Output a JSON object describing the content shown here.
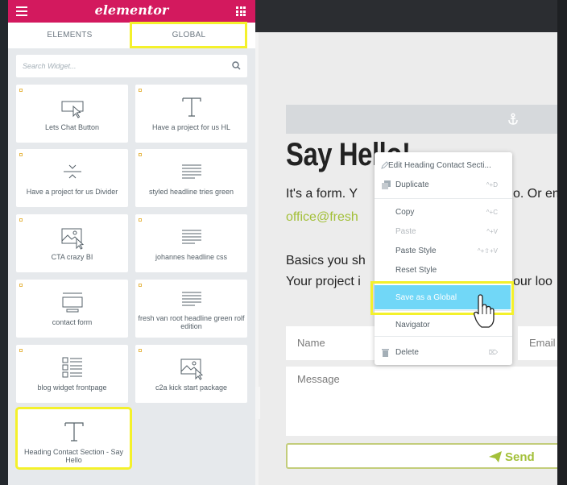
{
  "panel": {
    "logo": "elementor",
    "tabs": {
      "elements": "ELEMENTS",
      "global": "GLOBAL"
    },
    "search": {
      "placeholder": "Search Widget..."
    },
    "widgets": [
      {
        "label": "Lets Chat Button",
        "icon": "button-icon"
      },
      {
        "label": "Have a project for us HL",
        "icon": "heading-icon"
      },
      {
        "label": "Have a project for us Divider",
        "icon": "divider-icon"
      },
      {
        "label": "styled headline tries green",
        "icon": "text-editor-icon"
      },
      {
        "label": "CTA crazy BI",
        "icon": "image-icon"
      },
      {
        "label": "johannes headline css",
        "icon": "text-editor-icon"
      },
      {
        "label": "contact form",
        "icon": "form-icon"
      },
      {
        "label": "fresh van root headline green rolf edition",
        "icon": "text-editor-icon"
      },
      {
        "label": "blog widget frontpage",
        "icon": "posts-icon"
      },
      {
        "label": "c2a kick start package",
        "icon": "image-icon"
      },
      {
        "label": "Heading Contact Section - Say Hello",
        "icon": "heading-icon"
      }
    ]
  },
  "canvas": {
    "heading": "Say Hello!",
    "line1": "It's a form. Y",
    "line1_tail": "o. Or em",
    "email": "office@fresh",
    "line2": "Basics you sh",
    "line3": "Your project i",
    "line3_tail": "our loo",
    "name_placeholder": "Name",
    "email_placeholder": "Email",
    "message_placeholder": "Message",
    "send": "Send"
  },
  "context_menu": {
    "items": [
      {
        "label": "Edit Heading Contact Secti...",
        "shortcut": ""
      },
      {
        "label": "Duplicate",
        "shortcut": "^+D"
      },
      {
        "label": "Copy",
        "shortcut": "^+C"
      },
      {
        "label": "Paste",
        "shortcut": "^+V"
      },
      {
        "label": "Paste Style",
        "shortcut": "^+⇧+V"
      },
      {
        "label": "Reset Style",
        "shortcut": ""
      },
      {
        "label": "Save as a Global",
        "shortcut": ""
      },
      {
        "label": "Navigator",
        "shortcut": ""
      },
      {
        "label": "Delete",
        "shortcut": "⌦"
      }
    ]
  },
  "colors": {
    "brand": "#d3195e",
    "highlight": "#f4f12b",
    "accent_green": "#a3c039",
    "menu_hover": "#71d7f7"
  }
}
